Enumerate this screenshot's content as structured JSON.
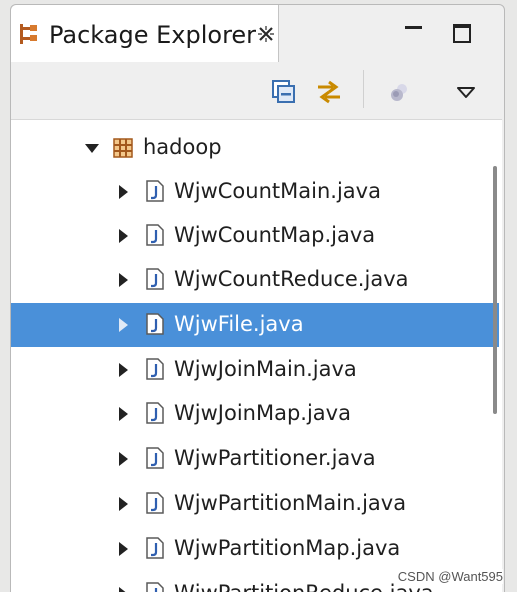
{
  "tab": {
    "title": "Package Explorer",
    "icon": "package-explorer-icon",
    "close_icon": "close-icon"
  },
  "window_controls": {
    "minimize_icon": "minimize-icon",
    "maximize_icon": "maximize-icon"
  },
  "toolbar": {
    "buttons": [
      {
        "icon": "collapse-all-icon"
      },
      {
        "icon": "link-with-editor-icon"
      },
      {
        "icon": "focus-on-active-task-icon"
      },
      {
        "icon": "view-menu-icon"
      }
    ]
  },
  "tree": {
    "package": {
      "label": "hadoop",
      "expanded": true,
      "icon": "package-icon"
    },
    "files": [
      {
        "label": "WjwCountMain.java",
        "selected": false
      },
      {
        "label": "WjwCountMap.java",
        "selected": false
      },
      {
        "label": "WjwCountReduce.java",
        "selected": false
      },
      {
        "label": "WjwFile.java",
        "selected": true
      },
      {
        "label": "WjwJoinMain.java",
        "selected": false
      },
      {
        "label": "WjwJoinMap.java",
        "selected": false
      },
      {
        "label": "WjwPartitioner.java",
        "selected": false
      },
      {
        "label": "WjwPartitionMain.java",
        "selected": false
      },
      {
        "label": "WjwPartitionMap.java",
        "selected": false
      },
      {
        "label": "WjwPartitionReduce.java",
        "selected": false
      }
    ]
  },
  "colors": {
    "selection": "#4a90d9",
    "background": "#ffffff",
    "chrome": "#efefef"
  },
  "watermark": "CSDN @Want595"
}
